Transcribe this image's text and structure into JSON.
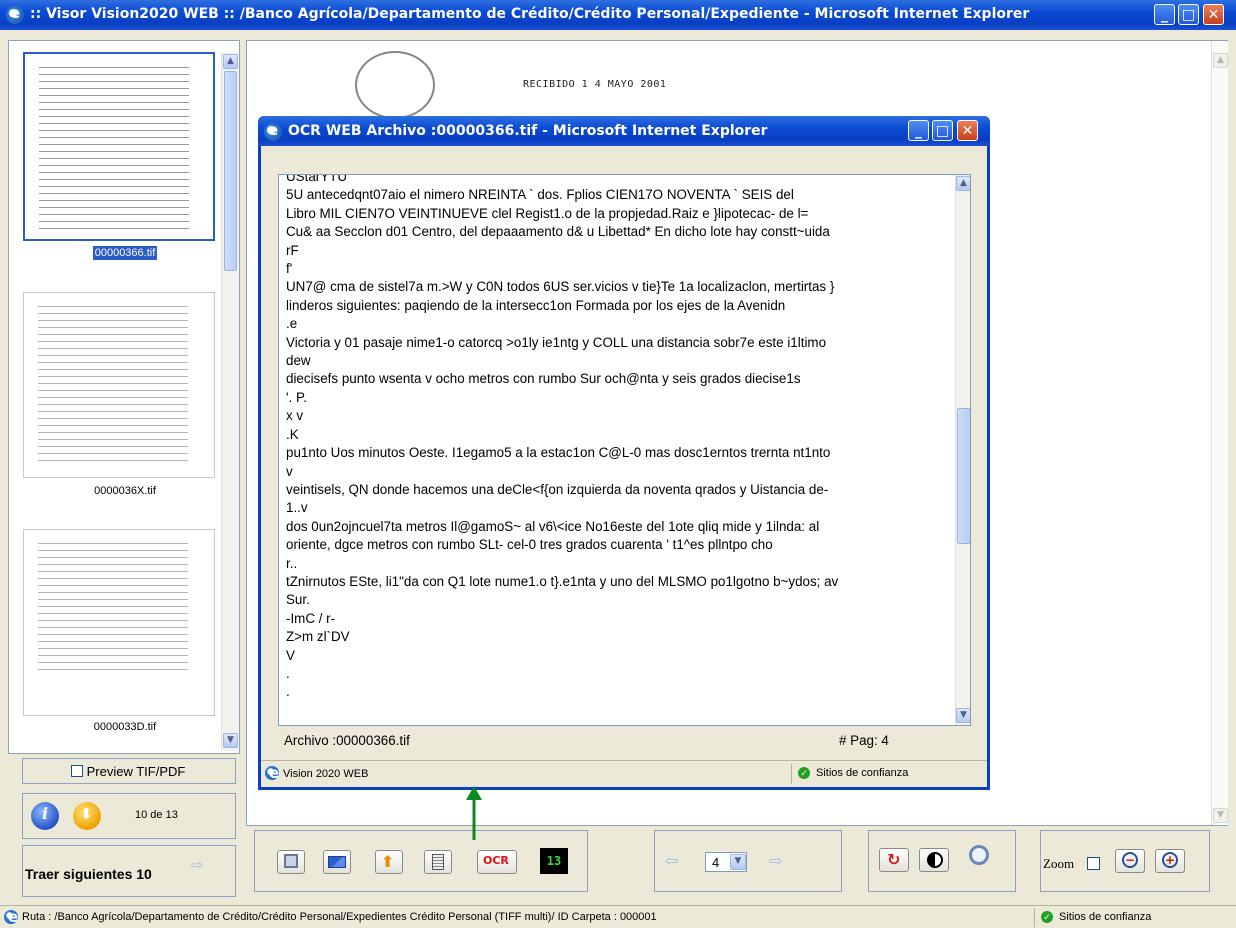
{
  "window": {
    "title": ":: Visor Vision2020 WEB :: /Banco Agrícola/Departamento de Crédito/Crédito Personal/Expediente - Microsoft Internet Explorer"
  },
  "thumbnails": [
    {
      "label": "00000366.tif",
      "selected": true
    },
    {
      "label": "0000036X.tif",
      "selected": false
    },
    {
      "label": "0000033D.tif",
      "selected": false
    }
  ],
  "preview": {
    "label": "Preview TIF/PDF",
    "checked": false
  },
  "pager": {
    "text": "10 de 13"
  },
  "load_more": {
    "label": "Traer siguientes 10"
  },
  "doc_stamp": {
    "text": "RECIBIDO 1 4 MAYO 2001"
  },
  "ocr_window": {
    "title": "OCR WEB Archivo :00000366.tif - Microsoft Internet Explorer",
    "lines": [
      "UStarYTU",
      "5U antecedqnt07aio el nimero NREINTA ` dos. Fplios CIEN17O NOVENTA ` SEIS del",
      "Libro MIL CIEN7O VEINTINUEVE clel Regist1.o de la propjedad.Raiz e }lipotecac- de l=",
      "Cu& aa Secclon d01 Centro, del depaaamento d& u Libettad* En dicho lote hay constt~uida",
      "rF",
      "f'",
      "UN7@ cma de sistel7a m.>W y C0N todos 6US ser.vicios v tie}Te 1a localizaclon, mertirtas }",
      "linderos siguientes: paqiendo de la intersecc1on Formada por los ejes de la Avenidn",
      ".e",
      "Victoria y 01 pasaje nime1-o catorcq >o1ly ie1ntg y COLL una distancia sobr7e este i1ltimo",
      "dew",
      "diecisefs punto wsenta v ocho metros con rumbo Sur och@nta y seis grados diecise1s",
      "'. P.",
      "x v",
      ".K",
      "pu1nto Uos minutos Oeste. I1egamo5 a la estac1on C@L-0 mas dosc1erntos trernta nt1nto",
      "v",
      "veintisels, QN donde hacemos una deCle<f{on izquierda da noventa qrados y Uistancia de-",
      "1..v",
      "dos 0un2ojncuel7ta metros Il@gamoS~ al v6\\<ice No16este del 1ote qliq mide y 1ilnda: al",
      "oriente, dgce metros con rumbo SLt- cel-0 tres grados cuarenta ' t1^es pllntpo cho",
      "r..",
      "tZnirnutos ESte, li1\"da con Q1 lote nume1.o t}.e1nta y uno del MLSMO po1lgotno b~ydos; av",
      "Sur.",
      "-ImC / r-",
      "Z>m zl`DV",
      "V",
      ".",
      "."
    ],
    "archivo": "Archivo :00000366.tif",
    "pag": "# Pag: 4",
    "status_left": "Vision 2020 WEB",
    "status_right": "Sitios de confianza"
  },
  "toolbar": {
    "ocr_label": "OCR",
    "count_badge": "13",
    "page_value": "4",
    "zoom_label": "Zoom"
  },
  "statusbar": {
    "route": "Ruta :  /Banco Agrícola/Departamento de Crédito/Crédito Personal/Expedientes Crédito Personal (TIFF multi)/ ID Carpeta : 000001",
    "zone": "Sitios de confianza"
  },
  "colors": {
    "titlebar": "#0a4ad4",
    "selection": "#2a5cc7",
    "badge_bg": "#000000",
    "badge_fg": "#39d839",
    "annotation_arrow": "#0b8a22"
  }
}
